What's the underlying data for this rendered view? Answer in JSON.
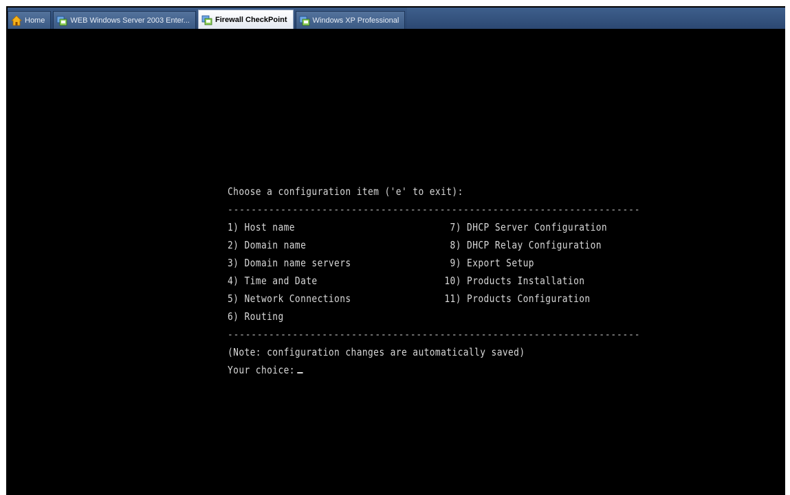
{
  "tabs": [
    {
      "label": "Home",
      "icon": "home-icon",
      "active": false
    },
    {
      "label": "WEB Windows Server 2003 Enter...",
      "icon": "vm-icon",
      "active": false
    },
    {
      "label": "Firewall CheckPoint",
      "icon": "vm-icon",
      "active": true
    },
    {
      "label": "Windows XP Professional",
      "icon": "vm-icon",
      "active": false
    }
  ],
  "terminal": {
    "prompt_title": "Choose a configuration item ('e' to exit):",
    "separator": "----------------------------------------------------------------------",
    "menu_left": [
      "1) Host name",
      "2) Domain name",
      "3) Domain name servers",
      "4) Time and Date",
      "5) Network Connections",
      "6) Routing"
    ],
    "menu_right": [
      " 7) DHCP Server Configuration",
      " 8) DHCP Relay Configuration",
      " 9) Export Setup",
      "10) Products Installation",
      "11) Products Configuration",
      ""
    ],
    "note": "(Note: configuration changes are automatically saved)",
    "choice_label": "Your choice:"
  },
  "colors": {
    "terminal_bg": "#000000",
    "terminal_fg": "#d8d8d8",
    "tabbar_bg": "#2c4872"
  }
}
